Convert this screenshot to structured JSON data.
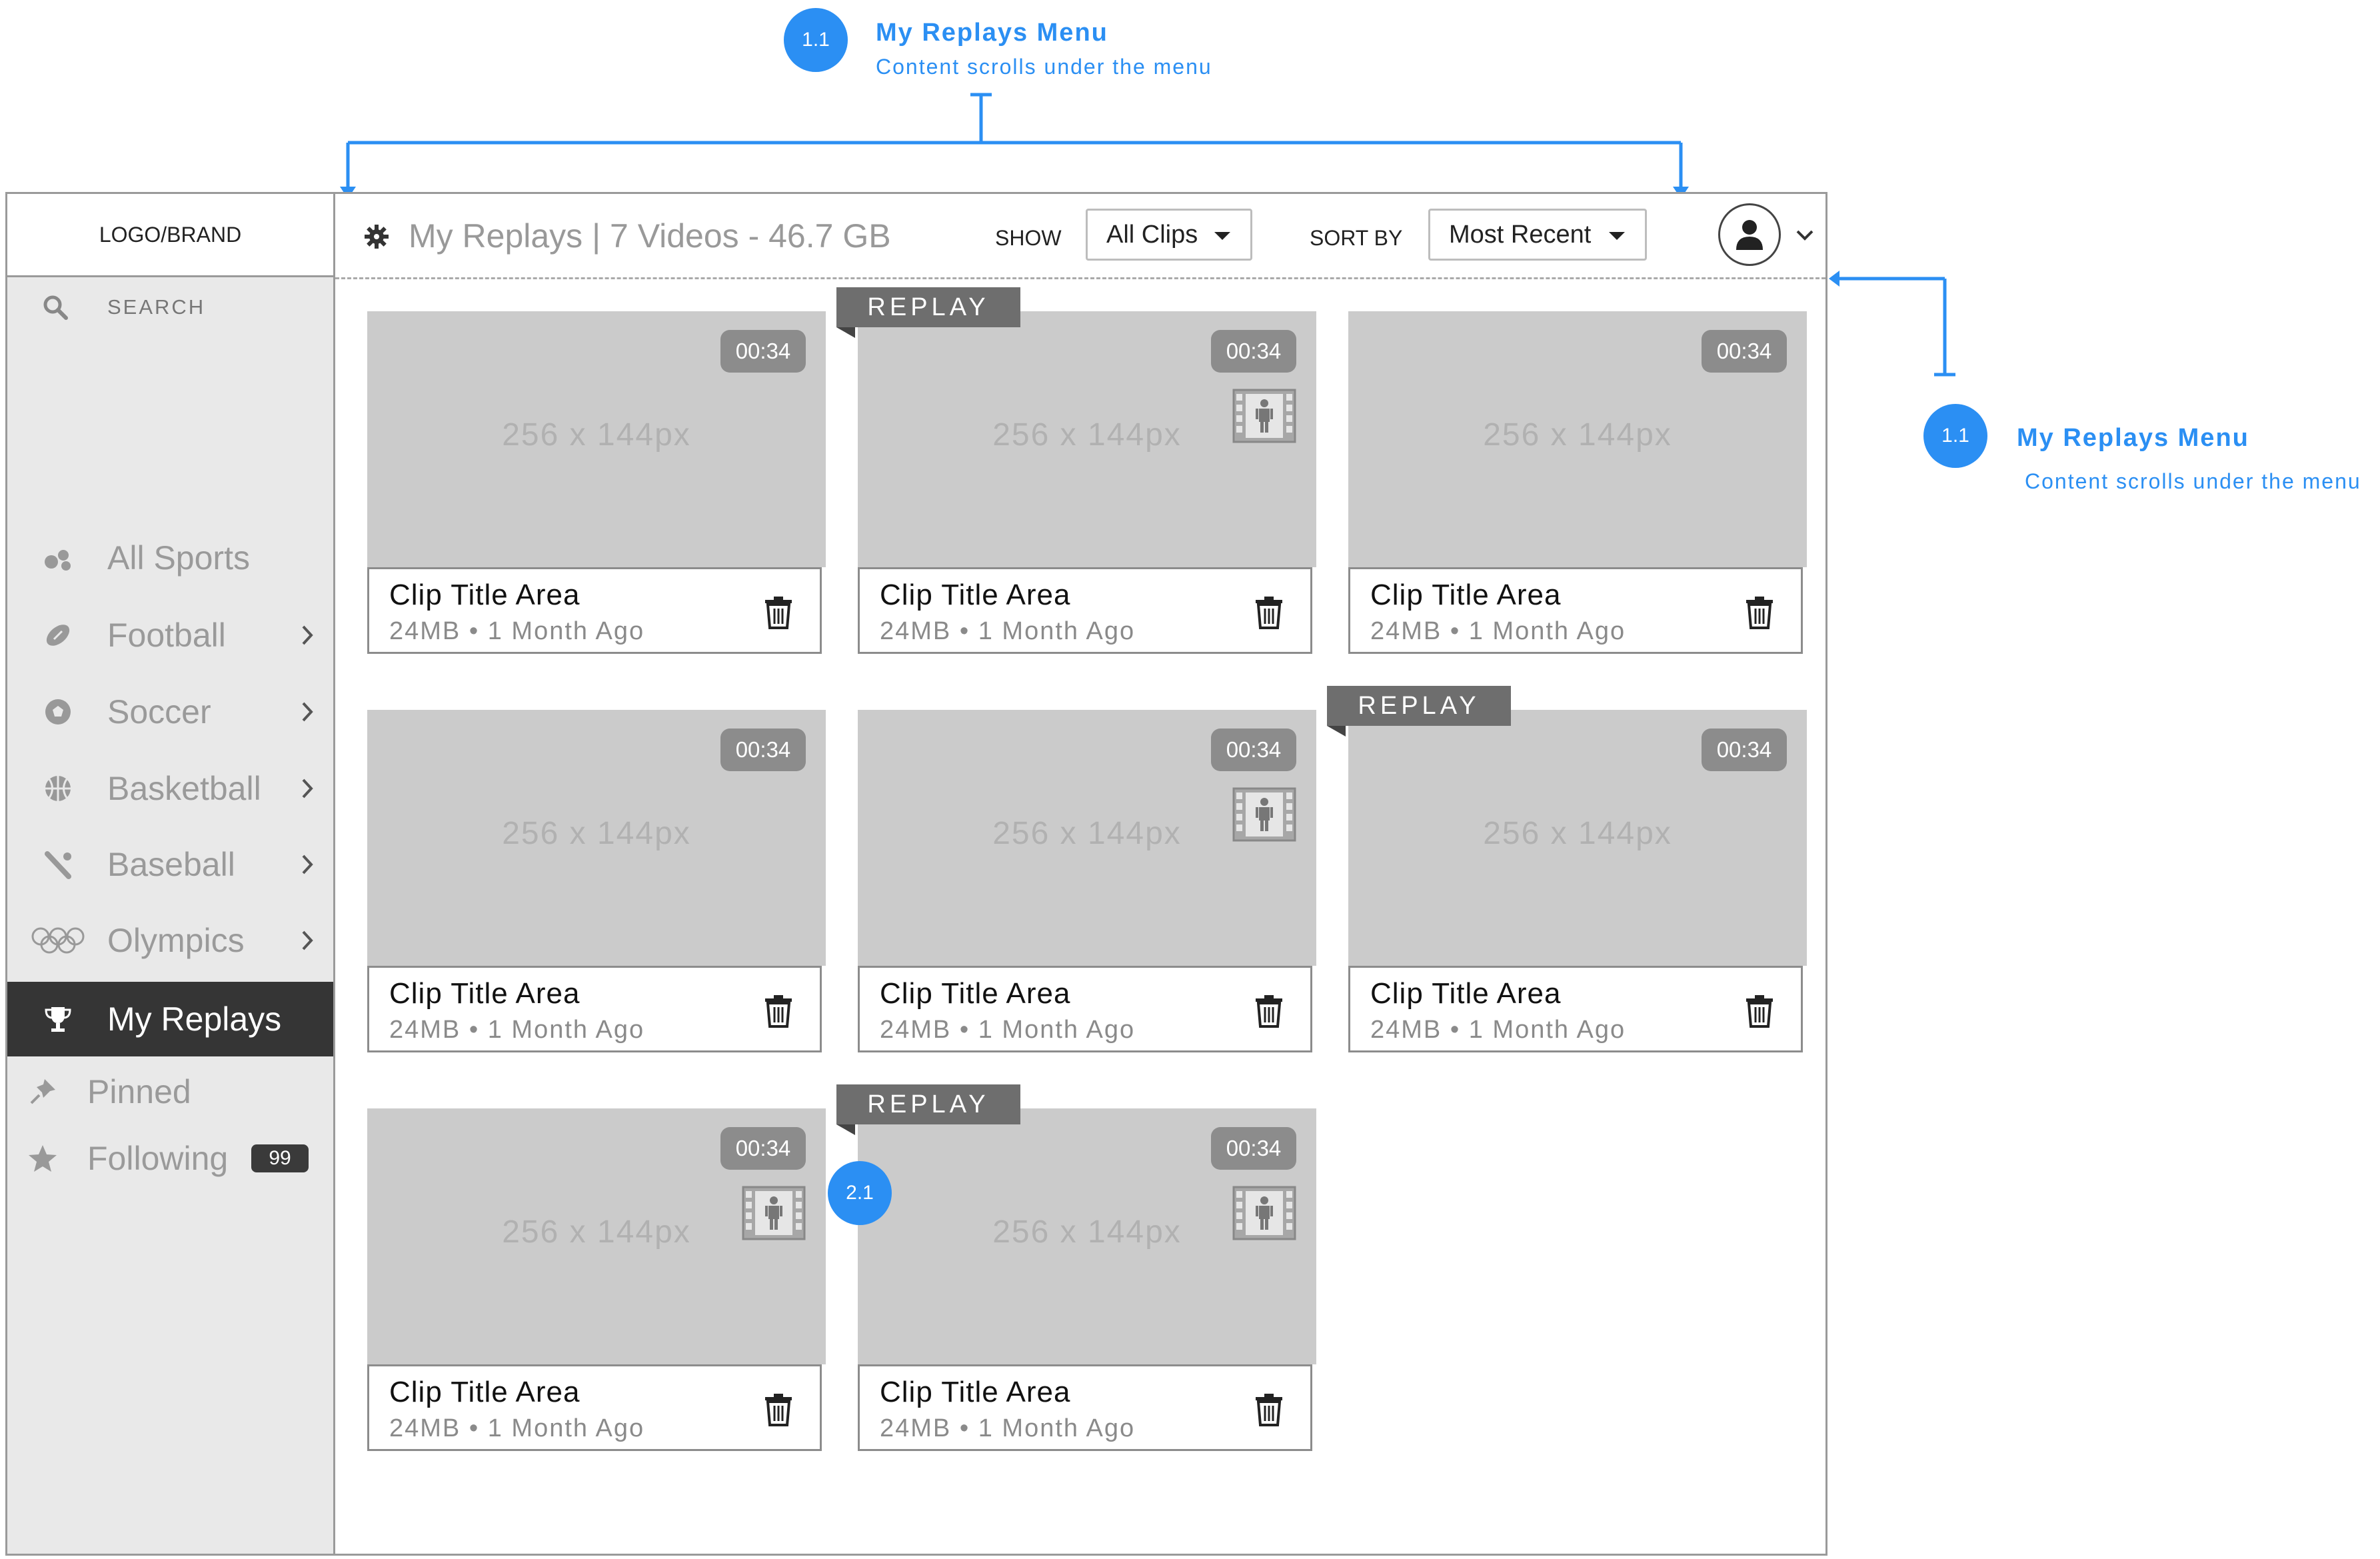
{
  "annotations": {
    "top": {
      "number": "1.1",
      "title": "My Replays Menu",
      "subtitle": "Content scrolls under the menu"
    },
    "right": {
      "number": "1.1",
      "title": "My Replays Menu",
      "subtitle": "Content scrolls under the menu"
    },
    "marker": {
      "number": "2.1"
    },
    "color": "#2b8ff3"
  },
  "sidebar": {
    "logo": "LOGO/BRAND",
    "search_label": "SEARCH",
    "items": [
      {
        "label": "All Sports",
        "icon": "all-sports-icon",
        "chevron": false
      },
      {
        "label": "Football",
        "icon": "football-icon",
        "chevron": true
      },
      {
        "label": "Soccer",
        "icon": "soccer-icon",
        "chevron": true
      },
      {
        "label": "Basketball",
        "icon": "basketball-icon",
        "chevron": true
      },
      {
        "label": "Baseball",
        "icon": "baseball-icon",
        "chevron": true
      },
      {
        "label": "Olympics",
        "icon": "olympics-icon",
        "chevron": true
      },
      {
        "label": "My Replays",
        "icon": "trophy-icon",
        "chevron": false,
        "active": true
      }
    ],
    "pinned_label": "Pinned",
    "following_label": "Following",
    "following_count": "99"
  },
  "header": {
    "title": "My Replays",
    "separator": "|",
    "summary": "7 Videos - 46.7 GB",
    "show_label": "SHOW",
    "show_value": "All Clips",
    "sort_label": "SORT BY",
    "sort_value": "Most Recent"
  },
  "clips": [
    {
      "title": "Clip Title Area",
      "size": "24MB",
      "age": "1 Month Ago",
      "duration": "00:34",
      "placeholder": "256 x 144px",
      "replay": false,
      "film_icon": false
    },
    {
      "title": "Clip Title Area",
      "size": "24MB",
      "age": "1 Month Ago",
      "duration": "00:34",
      "placeholder": "256 x 144px",
      "replay": true,
      "film_icon": true
    },
    {
      "title": "Clip Title Area",
      "size": "24MB",
      "age": "1 Month Ago",
      "duration": "00:34",
      "placeholder": "256 x 144px",
      "replay": false,
      "film_icon": false
    },
    {
      "title": "Clip Title Area",
      "size": "24MB",
      "age": "1 Month Ago",
      "duration": "00:34",
      "placeholder": "256 x 144px",
      "replay": false,
      "film_icon": false
    },
    {
      "title": "Clip Title Area",
      "size": "24MB",
      "age": "1 Month Ago",
      "duration": "00:34",
      "placeholder": "256 x 144px",
      "replay": false,
      "film_icon": true
    },
    {
      "title": "Clip Title Area",
      "size": "24MB",
      "age": "1 Month Ago",
      "duration": "00:34",
      "placeholder": "256 x 144px",
      "replay": true,
      "film_icon": false
    },
    {
      "title": "Clip Title Area",
      "size": "24MB",
      "age": "1 Month Ago",
      "duration": "00:34",
      "placeholder": "256 x 144px",
      "replay": false,
      "film_icon": true
    },
    {
      "title": "Clip Title Area",
      "size": "24MB",
      "age": "1 Month Ago",
      "duration": "00:34",
      "placeholder": "256 x 144px",
      "replay": true,
      "film_icon": true
    }
  ],
  "replay_tag_label": "REPLAY",
  "meta_separator": "•"
}
